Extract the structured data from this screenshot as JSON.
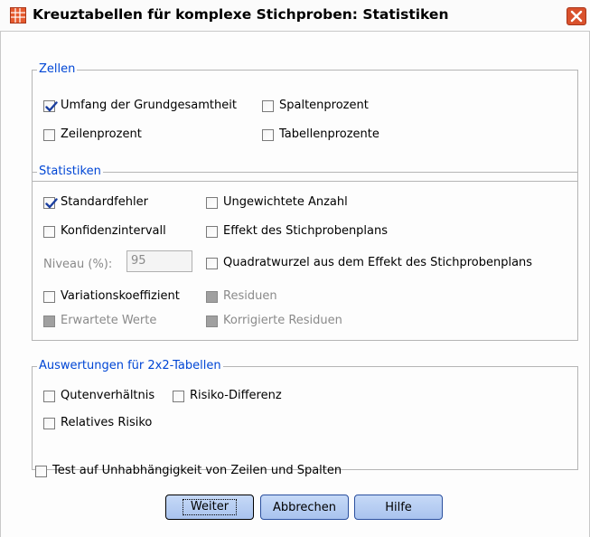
{
  "window": {
    "title": "Kreuztabellen für komplexe Stichproben: Statistiken",
    "icon": "table-icon",
    "close_icon": "close-icon"
  },
  "zellen": {
    "legend": "Zellen",
    "items": [
      {
        "label": "Umfang der Grundgesamtheit",
        "checked": true
      },
      {
        "label": "Spaltenprozent",
        "checked": false
      },
      {
        "label": "Zeilenprozent",
        "checked": false
      },
      {
        "label": "Tabellenprozente",
        "checked": false
      }
    ]
  },
  "statistiken": {
    "legend": "Statistiken",
    "standardfehler": "Standardfehler",
    "ungewichtete_anzahl": "Ungewichtete Anzahl",
    "konfidenzintervall": "Konfidenzintervall",
    "effekt": "Effekt des Stichprobenplans",
    "niveau_label": "Niveau (%):",
    "niveau_value": "95",
    "quadratwurzel": "Quadratwurzel aus dem Effekt des Stichprobenplans",
    "variationskoeffizient": "Variationskoeffizient",
    "residuen": "Residuen",
    "erwartete_werte": "Erwartete Werte",
    "korrigierte_residuen": "Korrigierte Residuen"
  },
  "auswertungen": {
    "legend": "Auswertungen für 2x2-Tabellen",
    "odds_ratio": "Qutenverhältnis",
    "risiko_differenz": "Risiko-Differenz",
    "relatives_risiko": "Relatives Risiko"
  },
  "test_unabhaengigkeit": "Test auf Unhabhängigkeit von Zeilen und Spalten",
  "buttons": {
    "weiter": "Weiter",
    "abbrechen": "Abbrechen",
    "hilfe": "Hilfe"
  },
  "colors": {
    "legend_text": "#0046d5",
    "button_fill": "#b4ccf2",
    "close_button": "#d9512c"
  }
}
